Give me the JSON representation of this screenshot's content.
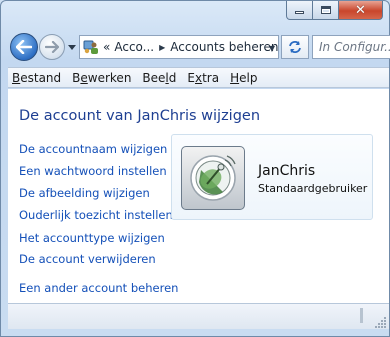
{
  "window": {
    "controls": {
      "minimize": "minimize",
      "maximize": "maximize",
      "close": "close"
    }
  },
  "navigation": {
    "back_icon": "back-arrow-icon",
    "forward_icon": "forward-arrow-icon",
    "history_icon": "chevron-down-icon"
  },
  "address_bar": {
    "overflow": "«",
    "crumbs": [
      "Acco...",
      "Accounts beheren"
    ],
    "dropdown_icon": "chevron-down-icon"
  },
  "search": {
    "placeholder": "In Configur..."
  },
  "menu": {
    "items": [
      {
        "label_underlined": "B",
        "label_rest": "estand"
      },
      {
        "label_underlined": "e",
        "label_prefix": "B",
        "label_rest": "werken"
      },
      {
        "label_underlined": "l",
        "label_prefix": "Bee",
        "label_rest": "d"
      },
      {
        "label_underlined": "x",
        "label_prefix": "E",
        "label_rest": "tra"
      },
      {
        "label_underlined": "H",
        "label_rest": "elp"
      }
    ]
  },
  "main": {
    "heading": "De account van JanChris wijzigen",
    "links": [
      "De accountnaam wijzigen",
      "Een wachtwoord instellen",
      "De afbeelding wijzigen",
      "Ouderlijk toezicht instellen",
      "Het accounttype wijzigen",
      "De account verwijderen"
    ],
    "secondary_link": "Een ander account beheren",
    "user": {
      "name": "JanChris",
      "role": "Standaardgebruiker",
      "avatar_icon": "satellite-dish-icon"
    }
  },
  "colors": {
    "heading": "#1e3f92",
    "link": "#1450b8",
    "close_button": "#c9462c"
  }
}
